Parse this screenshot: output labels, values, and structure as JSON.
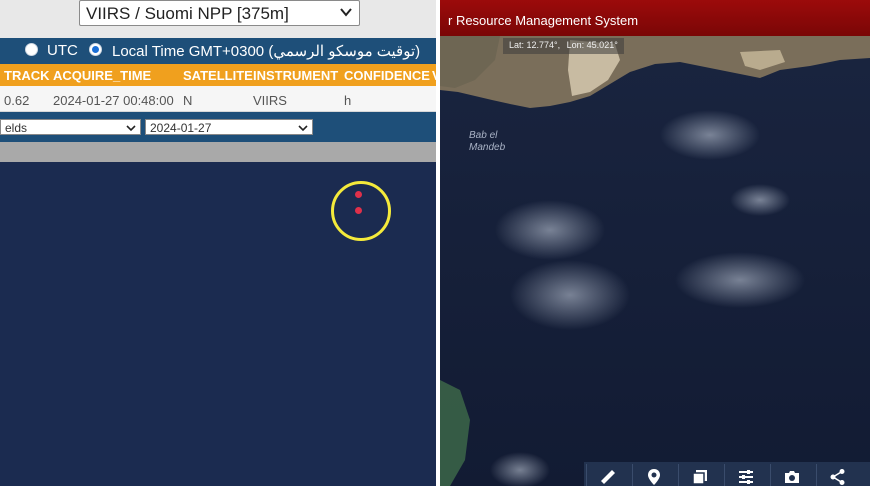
{
  "left_panel": {
    "sensor_select": {
      "value": "VIIRS / Suomi NPP [375m]"
    },
    "time_mode": {
      "utc_label": "UTC",
      "local_label": "Local Time GMT+0300 (توقيت موسكو الرسمي)",
      "selected": "local"
    },
    "table": {
      "columns": [
        "TRACK",
        "ACQUIRE_TIME",
        "SATELLITE",
        "INSTRUMENT",
        "CONFIDENCE",
        "V"
      ],
      "row": [
        "0.62",
        "2024-01-27 00:48:00",
        "N",
        "VIIRS",
        "h",
        ""
      ]
    },
    "filters": {
      "fields_value": "elds",
      "date_value": "2024-01-27"
    }
  },
  "right_panel": {
    "title": "r Resource Management System",
    "coords": {
      "lat": "Lat: 12.774°,",
      "lon": "Lon: 45.021°"
    },
    "place_label_line1": "Bab el",
    "place_label_line2": "Mandeb",
    "toolbar": [
      "ruler-icon",
      "location-pin-icon",
      "layers-icon",
      "sliders-icon",
      "camera-icon",
      "share-icon"
    ]
  },
  "colors": {
    "header_orange": "#f0a01e",
    "nav_blue": "#1e4f79",
    "title_red": "#9c0b0b",
    "hotspot_ring": "#f4ea3b",
    "fire_dot": "#e0304a",
    "sea": "#1b2b50"
  }
}
